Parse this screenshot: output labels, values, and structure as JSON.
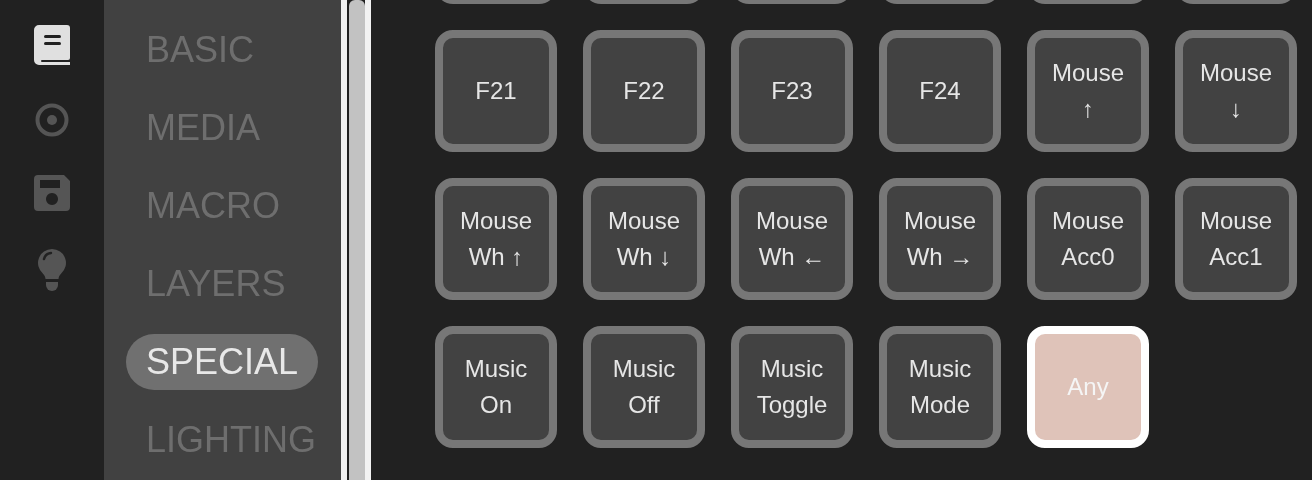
{
  "rail": [
    {
      "kind": "book",
      "selected": true
    },
    {
      "kind": "target",
      "selected": false
    },
    {
      "kind": "floppy",
      "selected": false
    },
    {
      "kind": "bulb",
      "selected": false
    }
  ],
  "menu": [
    {
      "label": "BASIC",
      "selected": false
    },
    {
      "label": "MEDIA",
      "selected": false
    },
    {
      "label": "MACRO",
      "selected": false
    },
    {
      "label": "LAYERS",
      "selected": false
    },
    {
      "label": "SPECIAL",
      "selected": true
    },
    {
      "label": "LIGHTING",
      "selected": false
    }
  ],
  "keys": [
    {
      "kind": "clipped"
    },
    {
      "kind": "clipped"
    },
    {
      "kind": "clipped"
    },
    {
      "kind": "clipped"
    },
    {
      "kind": "clipped"
    },
    {
      "kind": "clipped"
    },
    {
      "kind": "key",
      "lines": [
        "F21"
      ],
      "selected": false
    },
    {
      "kind": "key",
      "lines": [
        "F22"
      ],
      "selected": false
    },
    {
      "kind": "key",
      "lines": [
        "F23"
      ],
      "selected": false
    },
    {
      "kind": "key",
      "lines": [
        "F24"
      ],
      "selected": false
    },
    {
      "kind": "key",
      "lines": [
        "Mouse",
        "↑"
      ],
      "selected": false
    },
    {
      "kind": "key",
      "lines": [
        "Mouse",
        "↓"
      ],
      "selected": false
    },
    {
      "kind": "key",
      "lines": [
        "Mouse",
        "Wh ↑"
      ],
      "selected": false
    },
    {
      "kind": "key",
      "lines": [
        "Mouse",
        "Wh ↓"
      ],
      "selected": false
    },
    {
      "kind": "key",
      "lines": [
        "Mouse",
        "Wh ←"
      ],
      "selected": false
    },
    {
      "kind": "key",
      "lines": [
        "Mouse",
        "Wh →"
      ],
      "selected": false
    },
    {
      "kind": "key",
      "lines": [
        "Mouse",
        "Acc0"
      ],
      "selected": false
    },
    {
      "kind": "key",
      "lines": [
        "Mouse",
        "Acc1"
      ],
      "selected": false
    },
    {
      "kind": "key",
      "lines": [
        "Music",
        "On"
      ],
      "selected": false
    },
    {
      "kind": "key",
      "lines": [
        "Music",
        "Off"
      ],
      "selected": false
    },
    {
      "kind": "key",
      "lines": [
        "Music",
        "Toggle"
      ],
      "selected": false
    },
    {
      "kind": "key",
      "lines": [
        "Music",
        "Mode"
      ],
      "selected": false
    },
    {
      "kind": "key",
      "lines": [
        "Any"
      ],
      "selected": true
    }
  ]
}
